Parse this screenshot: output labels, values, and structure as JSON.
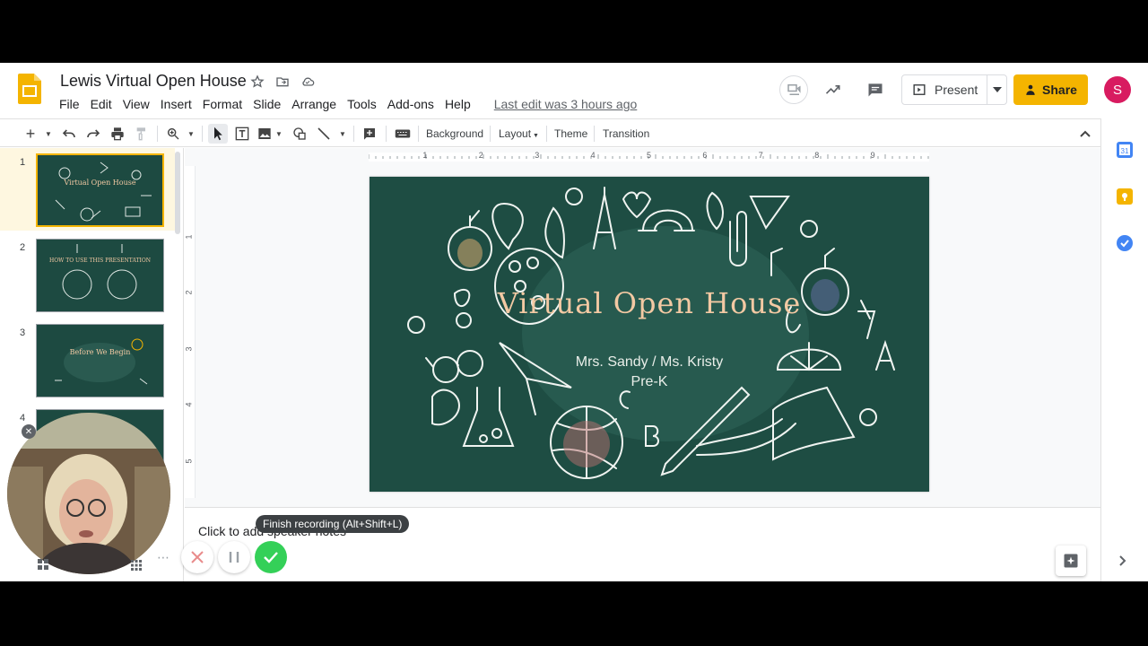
{
  "header": {
    "doc_title": "Lewis Virtual Open House",
    "menus": [
      "File",
      "Edit",
      "View",
      "Insert",
      "Format",
      "Slide",
      "Arrange",
      "Tools",
      "Add-ons",
      "Help"
    ],
    "last_edit": "Last edit was 3 hours ago",
    "present_label": "Present",
    "share_label": "Share",
    "avatar_letter": "S"
  },
  "toolbar": {
    "background_label": "Background",
    "layout_label": "Layout",
    "theme_label": "Theme",
    "transition_label": "Transition"
  },
  "filmstrip": {
    "slides": [
      {
        "num": "1",
        "thumb_text": "Virtual Open House"
      },
      {
        "num": "2",
        "thumb_text": "HOW TO USE THIS PRESENTATION"
      },
      {
        "num": "3",
        "thumb_text": "Before We Begin"
      },
      {
        "num": "4",
        "thumb_text": ""
      }
    ]
  },
  "ruler": {
    "h_marks": [
      "1",
      "2",
      "3",
      "4",
      "5",
      "6",
      "7",
      "8",
      "9"
    ],
    "v_marks": [
      "1",
      "2",
      "3",
      "4",
      "5"
    ]
  },
  "slide": {
    "title": "Virtual Open House",
    "subtitle_line1": "Mrs. Sandy / Ms. Kristy",
    "subtitle_line2": "Pre-K"
  },
  "notes": {
    "placeholder": "Click to add speaker notes"
  },
  "recording": {
    "tooltip": "Finish recording (Alt+Shift+L)"
  },
  "colors": {
    "slide_bg": "#1e4d43",
    "title_color": "#f3c9a3",
    "share_bg": "#f4b400",
    "avatar_bg": "#d81b60",
    "finish_green": "#34d058"
  }
}
